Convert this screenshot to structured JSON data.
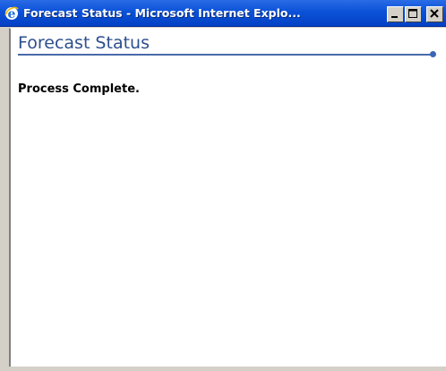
{
  "window": {
    "title": "Forecast Status - Microsoft Internet Explo...",
    "controls": {
      "minimize_icon": "minimize-icon",
      "maximize_icon": "maximize-icon",
      "close_icon": "close-icon"
    }
  },
  "page": {
    "heading": "Forecast Status",
    "status_message": "Process Complete."
  },
  "colors": {
    "titlebar_blue": "#0b52d8",
    "heading_text": "#2d4f8e",
    "rule": "#4a6aa8"
  }
}
